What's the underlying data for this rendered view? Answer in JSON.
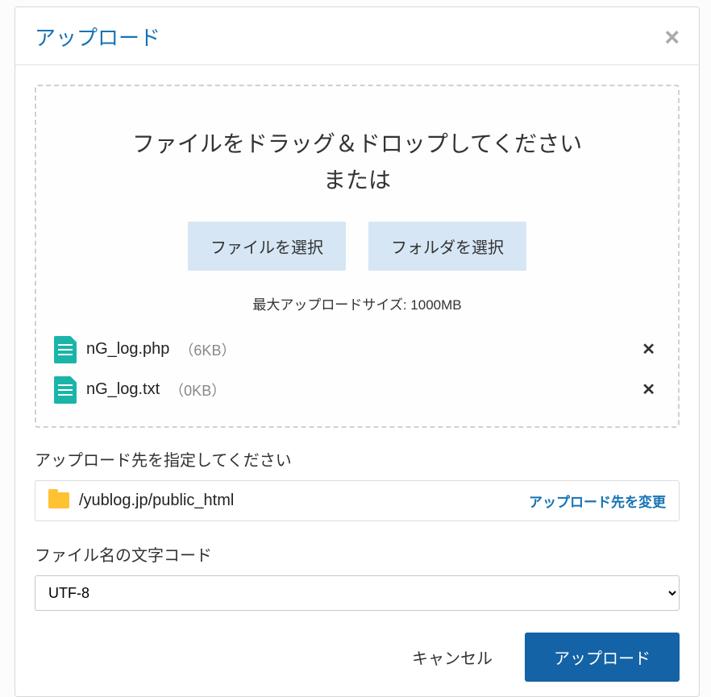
{
  "modal": {
    "title": "アップロード",
    "dropzone": {
      "instruction": "ファイルをドラッグ＆ドロップしてください\nまたは",
      "select_file_btn": "ファイルを選択",
      "select_folder_btn": "フォルダを選択",
      "max_size_text": "最大アップロードサイズ: 1000MB"
    },
    "files": [
      {
        "name": "nG_log.php",
        "size": "（6KB）"
      },
      {
        "name": "nG_log.txt",
        "size": "（0KB）"
      }
    ],
    "destination": {
      "label": "アップロード先を指定してください",
      "path": "/yublog.jp/public_html",
      "change_link": "アップロード先を変更"
    },
    "encoding": {
      "label": "ファイル名の文字コード",
      "value": "UTF-8"
    },
    "footer": {
      "cancel": "キャンセル",
      "upload": "アップロード"
    }
  }
}
